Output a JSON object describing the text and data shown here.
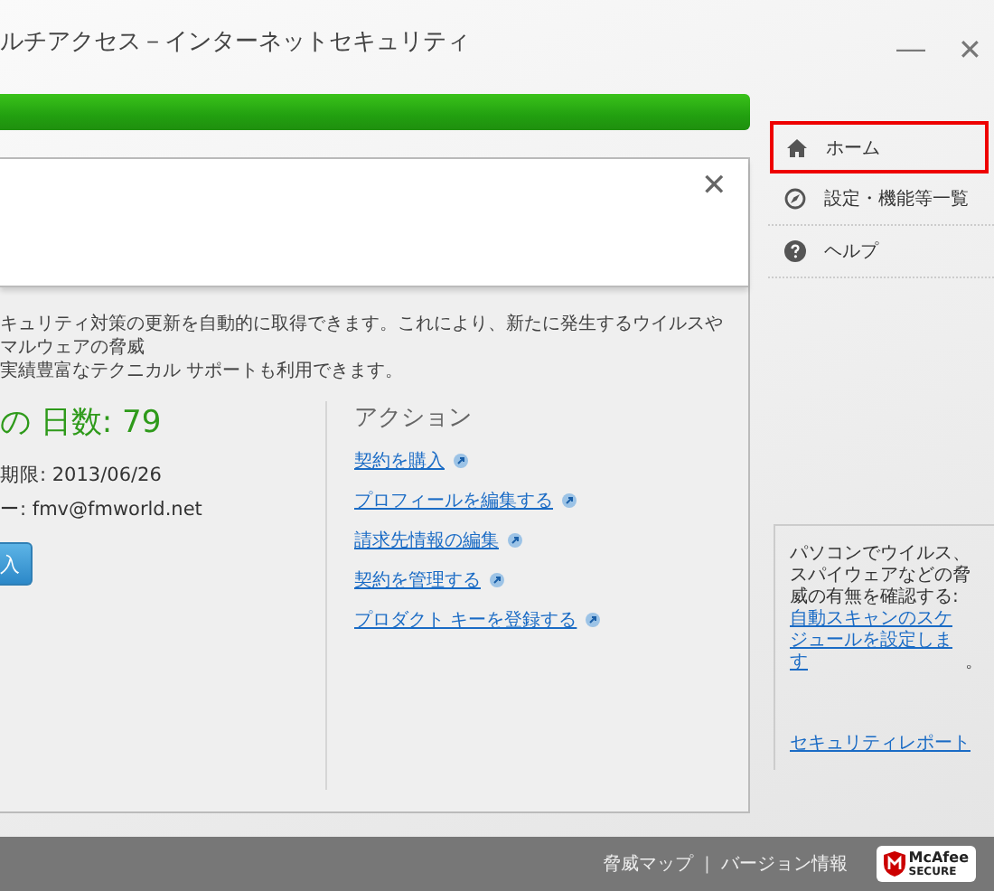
{
  "window": {
    "title": "ルチアクセス－インターネットセキュリティ",
    "minimize": "—",
    "close": "✕"
  },
  "status_bar": {
    "level": 1
  },
  "panel": {
    "close": "✕",
    "description": [
      "キュリティ対策の更新を自動的に取得できます。これにより、新たに発生するウイルスやマルウェアの脅威",
      "実績豊富なテクニカル サポートも利用できます。"
    ],
    "days": "の 日数: 79",
    "expiry": "期限: 2013/06/26",
    "account": "ー:  fmv@fmworld.net",
    "buy_button": "入",
    "actions_title": "アクション",
    "actions": [
      "契約を購入",
      "プロフィールを編集する",
      "請求先情報の編集",
      "契約を管理する",
      "プロダクト キーを登録する"
    ]
  },
  "sidebar": {
    "items": [
      {
        "label": "ホーム",
        "kind": "home",
        "selected": true
      },
      {
        "label": "設定・機能等一覧",
        "kind": "settings",
        "selected": false
      },
      {
        "label": "ヘルプ",
        "kind": "help",
        "selected": false
      }
    ],
    "tip": {
      "text": "パソコンでウイルス、スパイウェアなどの脅威の有無を確認する: ",
      "link": "自動スキャンのスケジュールを設定します",
      "end": "。"
    },
    "report_link": "セキュリティレポート"
  },
  "footer": {
    "links": [
      "脅威マップ",
      "バージョン情報"
    ],
    "separator": "|",
    "badge": [
      "McAfee",
      "SECURE"
    ]
  }
}
